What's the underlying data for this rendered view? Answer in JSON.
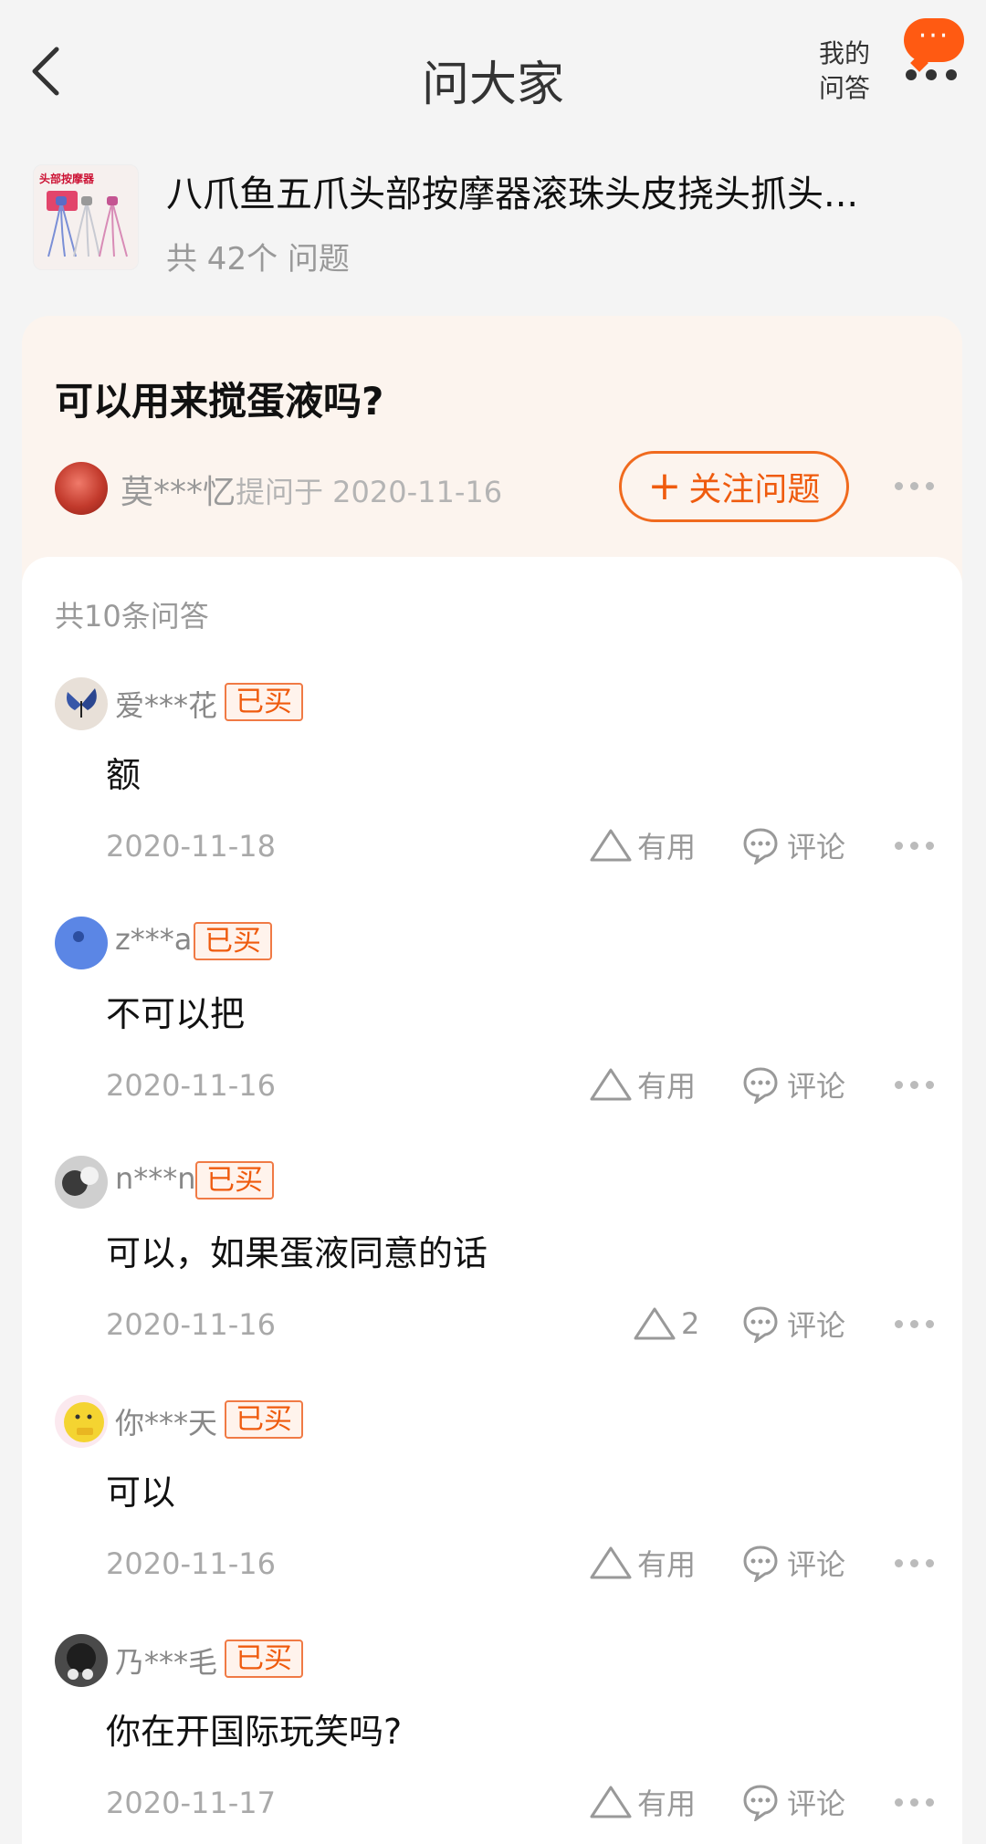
{
  "header": {
    "title": "问大家",
    "my_qa_line1": "我的",
    "my_qa_line2": "问答",
    "bubble_dots": "···"
  },
  "product": {
    "thumb_text": "头部按摩器",
    "title": "八爪鱼五爪头部按摩器滚珠头皮挠头抓头...",
    "question_count": "共 42个 问题"
  },
  "question": {
    "text": "可以用来搅蛋液吗?",
    "asker": "莫***忆",
    "asked_on": "提问于 2020-11-16",
    "follow_label": "关注问题",
    "follow_plus": "+"
  },
  "answers_section": {
    "count_label": "共10条问答",
    "items": [
      {
        "user": "爱***花",
        "badge": "已买",
        "text": "额",
        "date": "2020-11-18",
        "useful": "有用",
        "comment": "评论"
      },
      {
        "user": "z***a",
        "badge": "已买",
        "text": "不可以把",
        "date": "2020-11-16",
        "useful": "有用",
        "comment": "评论"
      },
      {
        "user": "n***n",
        "badge": "已买",
        "text": "可以，如果蛋液同意的话",
        "date": "2020-11-16",
        "useful": "2",
        "comment": "评论"
      },
      {
        "user": "你***天",
        "badge": "已买",
        "text": "可以",
        "date": "2020-11-16",
        "useful": "有用",
        "comment": "评论"
      },
      {
        "user": "乃***毛",
        "badge": "已买",
        "text": "你在开国际玩笑吗?",
        "date": "2020-11-17",
        "useful": "有用",
        "comment": "评论"
      }
    ]
  },
  "colors": {
    "accent": "#ef5b0e",
    "card_bg": "#fcf4ee",
    "page_bg": "#f4f4f4"
  }
}
